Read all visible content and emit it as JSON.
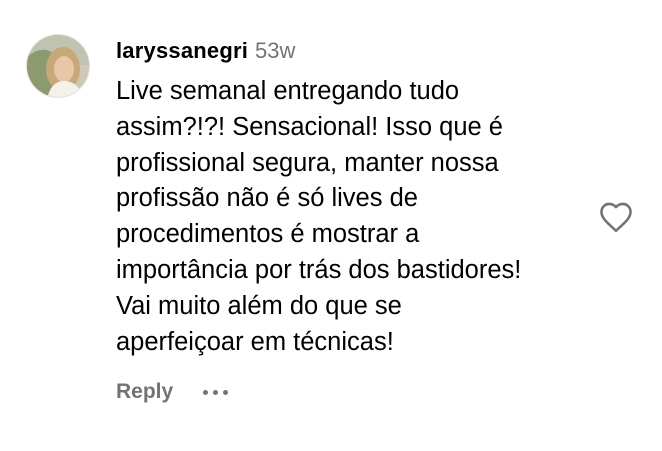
{
  "comment": {
    "username": "laryssanegri",
    "timestamp": "53w",
    "text_lines": [
      "Live semanal entregando tudo",
      "assim?!?! Sensacional! Isso que é",
      "profissional segura, manter nossa",
      "profissão não é só lives de",
      "procedimentos é mostrar a",
      "importância por trás dos bastidores!",
      "Vai muito além do que se",
      "aperfeiçoar em técnicas!"
    ],
    "reply_label": "Reply",
    "more_icon": "more-options-icon",
    "like_icon": "heart-icon",
    "avatar_icon": "avatar"
  },
  "colors": {
    "text": "#000000",
    "secondary": "#737373",
    "background": "#ffffff"
  }
}
